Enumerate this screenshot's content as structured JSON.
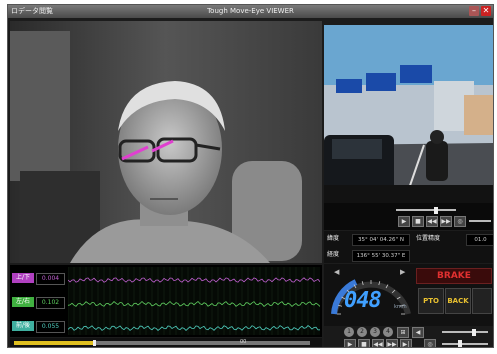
{
  "window": {
    "title_left": "ロデータ閲覧",
    "title_center": "Tough Move-Eye VIEWER",
    "minimize_icon": "minimize-icon",
    "close_icon": "close-icon"
  },
  "gps": {
    "lat_label": "緯度",
    "lat_value": "35° 04' 04.26\" N",
    "lon_label": "経度",
    "lon_value": "136° 55' 30.37\" E",
    "accuracy_label": "位置精度",
    "accuracy_value": "01.0"
  },
  "sensor": {
    "rows": [
      {
        "label": "上/下",
        "value": "0.004",
        "label_color": "#b040c0",
        "value_color": "#c060d0"
      },
      {
        "label": "左/右",
        "value": "0.102",
        "label_color": "#40b040",
        "value_color": "#60d060"
      },
      {
        "label": "前/後",
        "value": "0.055",
        "label_color": "#40b0a0",
        "value_color": "#50d0c0"
      }
    ]
  },
  "seek": {
    "position": 0.27,
    "label": "00"
  },
  "speed": {
    "value": "048",
    "unit": "km/h",
    "brake_label": "BRAKE",
    "pto_label": "PTO",
    "back_label": "BACK"
  },
  "channels": [
    "1",
    "2",
    "3",
    "4"
  ],
  "colors": {
    "speed_digits": "#40a0ff",
    "brake_text": "#e03030",
    "button_text": "#e8c030",
    "seek_fill": "#e0c020"
  }
}
